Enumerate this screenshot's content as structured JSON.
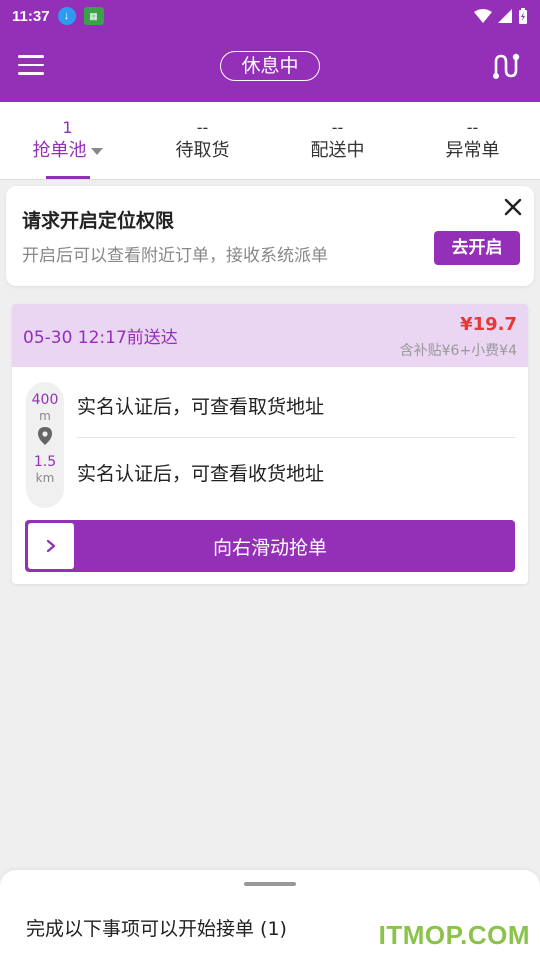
{
  "status_bar": {
    "time": "11:37"
  },
  "header": {
    "status_label": "休息中"
  },
  "tabs": [
    {
      "count": "1",
      "label": "抢单池"
    },
    {
      "count": "--",
      "label": "待取货"
    },
    {
      "count": "--",
      "label": "配送中"
    },
    {
      "count": "--",
      "label": "异常单"
    }
  ],
  "permission_card": {
    "title": "请求开启定位权限",
    "description": "开启后可以查看附近订单，接收系统派单",
    "button_label": "去开启"
  },
  "order": {
    "deadline": "05-30 12:17前送达",
    "price": "¥19.7",
    "subsidy": "含补贴¥6+小费¥4",
    "pickup_distance": "400",
    "pickup_unit": "m",
    "delivery_distance": "1.5",
    "delivery_unit": "km",
    "pickup_address": "实名认证后，可查看取货地址",
    "delivery_address": "实名认证后，可查看收货地址",
    "slide_label": "向右滑动抢单"
  },
  "bottom_sheet": {
    "message": "完成以下事项可以开始接单 (1)"
  },
  "watermark": "ITMOP.COM",
  "colors": {
    "brand": "#9430b8",
    "price": "#e53935",
    "header_tint": "#ead5f2"
  }
}
